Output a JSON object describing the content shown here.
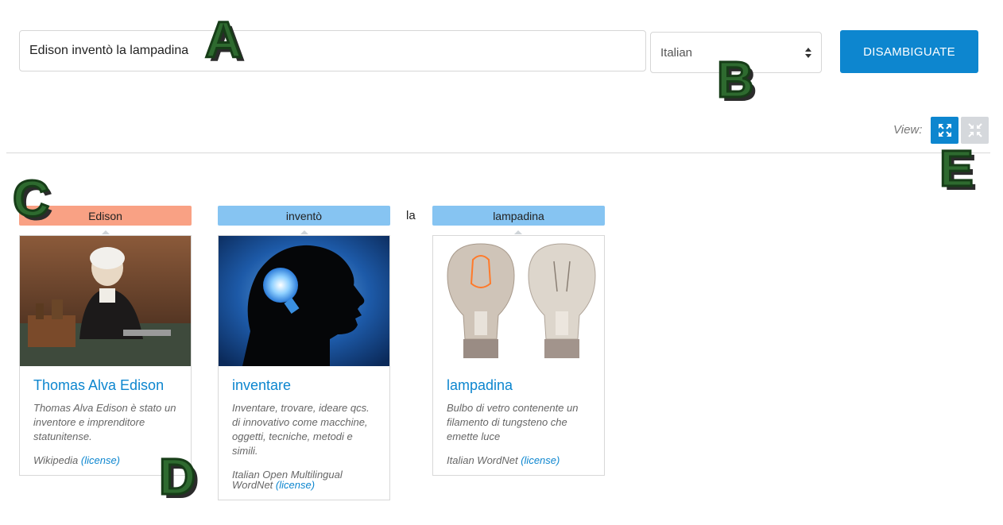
{
  "form": {
    "text_value": "Edison inventò la lampadina",
    "language": "Italian",
    "submit_label": "DISAMBIGUATE"
  },
  "view": {
    "label": "View:",
    "expand_icon": "expand-icon",
    "collapse_icon": "collapse-icon",
    "active": "expand"
  },
  "tokens": [
    {
      "text": "Edison",
      "color": "#f9a184"
    },
    {
      "text": "inventò",
      "color": "#86c4f2"
    },
    {
      "plain": "la"
    },
    {
      "text": "lampadina",
      "color": "#86c4f2"
    }
  ],
  "cards": [
    {
      "title": "Thomas Alva Edison",
      "description": "Thomas Alva Edison è stato un inventore e imprenditore statunitense.",
      "source": "Wikipedia",
      "license": "(license)",
      "image": "portrait-photo"
    },
    {
      "title": "inventare",
      "description": "Inventare, trovare, ideare qcs. di innovativo come macchine, oggetti, tecniche, metodi e simili.",
      "source": "Italian Open Multilingual WordNet",
      "license": "(license)",
      "image": "lightbulb-head-silhouette"
    },
    {
      "title": "lampadina",
      "description": "Bulbo di vetro contenente un filamento di tungsteno che emette luce",
      "source": "Italian WordNet",
      "license": "(license)",
      "image": "light-bulbs-photo"
    }
  ],
  "annotations": [
    "A",
    "B",
    "C",
    "D",
    "E"
  ],
  "colors": {
    "accent": "#0d86cf",
    "tag_entity": "#f9a184",
    "tag_concept": "#86c4f2",
    "annotation": "#2e6a2f"
  }
}
